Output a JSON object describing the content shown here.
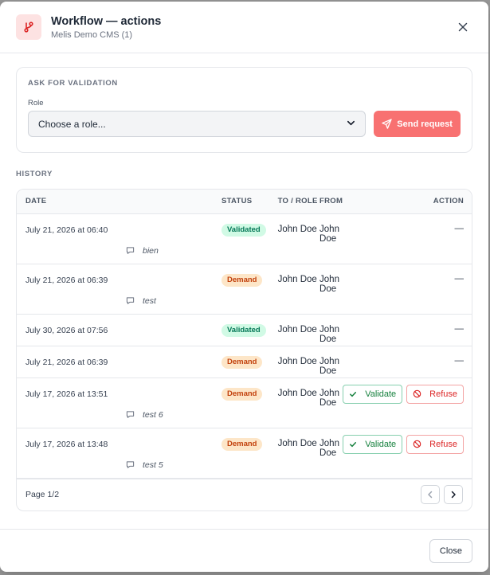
{
  "header": {
    "title": "Workflow — actions",
    "subtitle": "Melis Demo CMS (1)"
  },
  "ask": {
    "section_label": "ASK FOR VALIDATION",
    "role_label": "Role",
    "role_selected": "Choose a role...",
    "send_label": "Send request"
  },
  "history": {
    "section_label": "HISTORY",
    "columns": [
      "DATE",
      "STATUS",
      "TO / ROLE",
      "FROM",
      "ACTION"
    ],
    "rows": [
      {
        "date": "July 21, 2026 at 06:40",
        "status": "Validated",
        "to": "John Doe",
        "from": "John Doe",
        "action": "—",
        "comment": "bien"
      },
      {
        "date": "July 21, 2026 at 06:39",
        "status": "Demand",
        "to": "John Doe",
        "from": "John Doe",
        "action": "—",
        "comment": "test"
      },
      {
        "date": "July 30, 2026 at 07:56",
        "status": "Validated",
        "to": "John Doe",
        "from": "John Doe",
        "action": "—",
        "comment": ""
      },
      {
        "date": "July 21, 2026 at 06:39",
        "status": "Demand",
        "to": "John Doe",
        "from": "John Doe",
        "action": "—",
        "comment": ""
      },
      {
        "date": "July 17, 2026 at 13:51",
        "status": "Demand",
        "to": "John Doe",
        "from": "John Doe",
        "action": "buttons",
        "comment": "test 6"
      },
      {
        "date": "July 17, 2026 at 13:48",
        "status": "Demand",
        "to": "John Doe",
        "from": "John Doe",
        "action": "buttons",
        "comment": "test 5"
      }
    ],
    "validate_label": "Validate",
    "refuse_label": "Refuse",
    "page_text": "Page 1/2"
  },
  "footer": {
    "close_label": "Close"
  },
  "colors": {
    "accent": "#f87171",
    "validated_bg": "#d1fae5",
    "validated_fg": "#047857",
    "demand_bg": "#fde6c8",
    "demand_fg": "#c2410c"
  },
  "icons": {
    "header": "workflow-branch-icon",
    "close": "close-icon",
    "send": "send-icon",
    "comment": "comment-icon",
    "validate": "check-icon",
    "refuse": "ban-icon",
    "prev": "chevron-left-icon",
    "next": "chevron-right-icon",
    "select": "chevron-down-icon"
  }
}
